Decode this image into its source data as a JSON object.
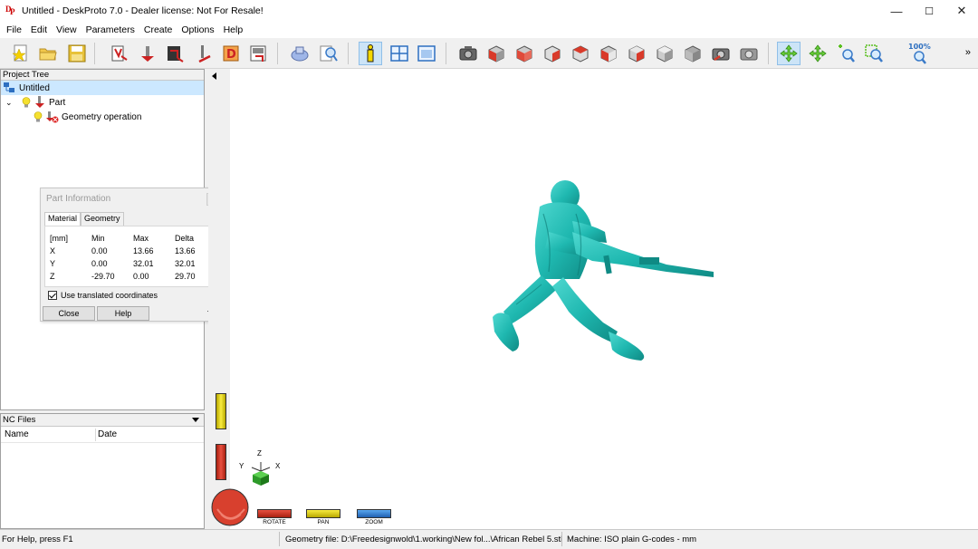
{
  "window": {
    "title": "Untitled - DeskProto 7.0 - Dealer license: Not For Resale!",
    "minimize": "—",
    "maximize": "☐",
    "close": "✕"
  },
  "menu": [
    "File",
    "Edit",
    "View",
    "Parameters",
    "Create",
    "Options",
    "Help"
  ],
  "toolbar": {
    "zoom_label": "100%",
    "more": "»"
  },
  "project_tree": {
    "header": "Project Tree",
    "root": "Untitled",
    "part": "Part",
    "operation": "Geometry operation"
  },
  "nc_files": {
    "header": "NC Files",
    "col_name": "Name",
    "col_date": "Date"
  },
  "part_info": {
    "title": "Part Information",
    "tabs": [
      "Material",
      "Geometry"
    ],
    "headers": [
      "[mm]",
      "Min",
      "Max",
      "Delta"
    ],
    "rows": [
      [
        "X",
        "0.00",
        "13.66",
        "13.66"
      ],
      [
        "Y",
        "0.00",
        "32.01",
        "32.01"
      ],
      [
        "Z",
        "-29.70",
        "0.00",
        "29.70"
      ]
    ],
    "checkbox": "Use translated coordinates",
    "close_btn": "Close",
    "help_btn": "Help"
  },
  "axes": {
    "x": "X",
    "y": "Y",
    "z": "Z"
  },
  "mouse_modes": {
    "rotate": "ROTATE",
    "pan": "PAN",
    "zoom": "ZOOM"
  },
  "status": {
    "help": "For Help, press F1",
    "geometry": "Geometry file: D:\\Freedesignwold\\1.working\\New fol...\\African Rebel 5.stl",
    "machine": "Machine: ISO plain G-codes - mm"
  },
  "colors": {
    "model": "#1fb8b0",
    "rotate": "#d43a2a",
    "pan": "#e8d81a",
    "zoom": "#2f7fd0",
    "selection": "#cce8ff"
  }
}
